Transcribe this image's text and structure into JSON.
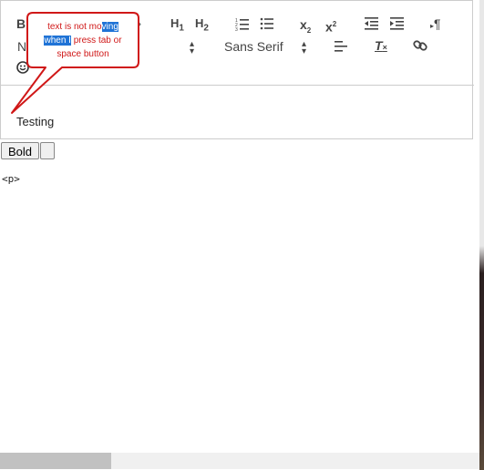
{
  "toolbar": {
    "bold": "B",
    "h1": "H",
    "h1_sub": "1",
    "h2": "H",
    "h2_sub": "2",
    "sub_x": "x",
    "sub_2": "2",
    "sup_x": "x",
    "sup_2": "2",
    "direction": "¶",
    "header_select": "Normal",
    "font_select": "Sans Serif",
    "clean": "T"
  },
  "editor": {
    "content": "Testing"
  },
  "buttons": {
    "bold": "Bold",
    "empty": ""
  },
  "output": {
    "html": "<p>"
  },
  "callout": {
    "part1": "text is not mo",
    "part2_hl": "ving",
    "part3_hl": "when I",
    "part4": " press tab or",
    "part5": "space button"
  },
  "colors": {
    "callout_border": "#d01818",
    "highlight": "#1f73d6"
  }
}
